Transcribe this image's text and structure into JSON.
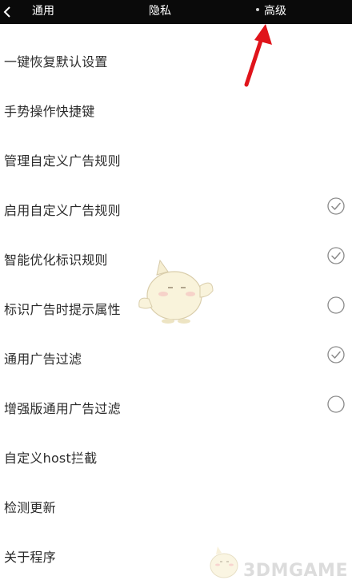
{
  "topbar": {
    "back_icon": "chevron-left-icon",
    "tabs": [
      {
        "label": "通用"
      },
      {
        "label": "隐私"
      },
      {
        "label": "高级",
        "active": true
      }
    ]
  },
  "settings": {
    "items": [
      {
        "label": "一键恢复默认设置"
      },
      {
        "label": "手势操作快捷键"
      },
      {
        "label": "管理自定义广告规则"
      },
      {
        "label": "启用自定义广告规则",
        "checked": true
      },
      {
        "label": "智能优化标识规则",
        "checked": true
      },
      {
        "label": "标识广告时提示属性",
        "checked": false
      },
      {
        "label": "通用广告过滤",
        "checked": true
      },
      {
        "label": "增强版通用广告过滤",
        "checked": false
      },
      {
        "label": "自定义host拦截"
      },
      {
        "label": "检测更新"
      },
      {
        "label": "关于程序"
      }
    ]
  },
  "watermark": {
    "text": "3DMGAME"
  },
  "colors": {
    "topbar_bg": "#0a0a0a",
    "text": "#2b2b2b",
    "check_circle": "#8a8a8a",
    "annotation_arrow": "#e0141b",
    "watermark": "#d9d9d9"
  }
}
